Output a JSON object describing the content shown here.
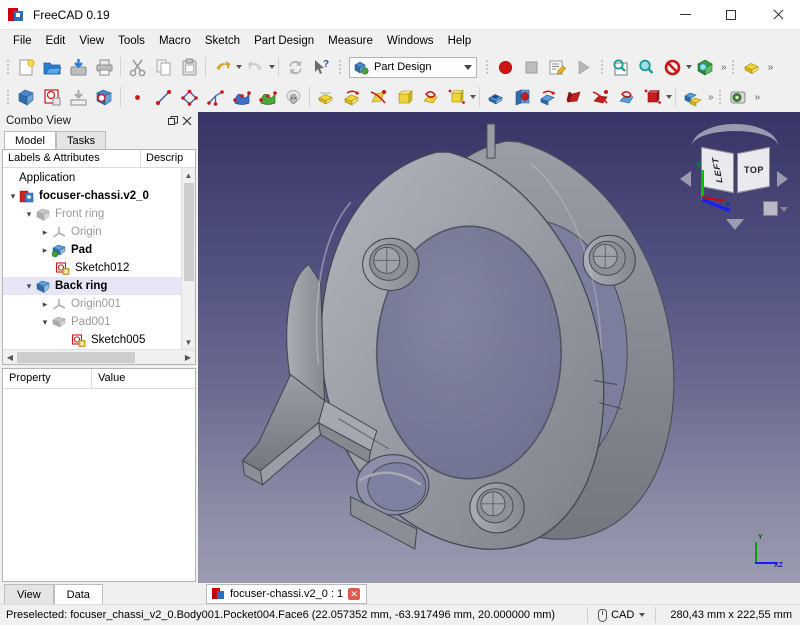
{
  "window": {
    "title": "FreeCAD 0.19",
    "app_icon": "freecad-logo-icon",
    "minimize": "minimize-icon",
    "maximize": "maximize-icon",
    "close": "close-icon"
  },
  "menubar": {
    "items": [
      {
        "label": "File"
      },
      {
        "label": "Edit"
      },
      {
        "label": "View"
      },
      {
        "label": "Tools"
      },
      {
        "label": "Macro"
      },
      {
        "label": "Sketch"
      },
      {
        "label": "Part Design"
      },
      {
        "label": "Measure"
      },
      {
        "label": "Windows"
      },
      {
        "label": "Help"
      }
    ]
  },
  "toolbar_row1": {
    "file_group": [
      {
        "name": "new-document-icon",
        "title": "New"
      },
      {
        "name": "open-document-icon",
        "title": "Open"
      },
      {
        "name": "save-document-icon",
        "title": "Save"
      },
      {
        "name": "print-document-icon",
        "title": "Print"
      }
    ],
    "edit_group": [
      {
        "name": "cut-icon",
        "title": "Cut"
      },
      {
        "name": "copy-icon",
        "title": "Copy"
      },
      {
        "name": "paste-icon",
        "title": "Paste"
      }
    ],
    "history_group": [
      {
        "name": "undo-icon",
        "title": "Undo"
      },
      {
        "name": "redo-icon",
        "title": "Redo"
      },
      {
        "name": "refresh-icon",
        "title": "Refresh"
      },
      {
        "name": "whats-this-icon",
        "title": "What's This"
      }
    ],
    "workbench": {
      "label": "Part Design",
      "icon": "part-design-workbench-icon",
      "dropdown": "chevron-down-icon"
    },
    "macro_group": [
      {
        "name": "macro-record-icon",
        "title": "Macro recording"
      },
      {
        "name": "macro-stop-icon",
        "title": "Stop macro recording"
      },
      {
        "name": "macro-edit-icon",
        "title": "Macros"
      },
      {
        "name": "macro-execute-icon",
        "title": "Execute macro"
      }
    ],
    "view_group": [
      {
        "name": "fit-all-icon",
        "title": "Fit all"
      },
      {
        "name": "zoom-icon",
        "title": "Zoom"
      },
      {
        "name": "draw-style-icon",
        "title": "Draw style"
      },
      {
        "name": "axonometric-view-icon",
        "title": "Axonometric"
      }
    ],
    "overflow": "double-chevron-icon",
    "extra_group": [
      {
        "name": "pad-yellow-icon",
        "title": "Pad"
      }
    ]
  },
  "toolbar_row2": {
    "body_group": [
      {
        "name": "create-body-icon",
        "title": "Create body"
      },
      {
        "name": "create-sketch-icon",
        "title": "Create sketch"
      },
      {
        "name": "attach-sketch-icon",
        "title": "Attach sketch"
      },
      {
        "name": "validate-sketch-icon",
        "title": "Validate sketch"
      }
    ],
    "sketcher_group": [
      {
        "name": "point-icon",
        "title": "Point"
      },
      {
        "name": "line-icon",
        "title": "Line"
      },
      {
        "name": "polyline-icon",
        "title": "Polyline"
      },
      {
        "name": "arc-icon",
        "title": "Arc"
      },
      {
        "name": "bspline-icon",
        "title": "B-spline"
      },
      {
        "name": "periodic-bspline-icon",
        "title": "Periodic B-spline"
      },
      {
        "name": "sheep-icon",
        "title": "Sketcher tool"
      }
    ],
    "additive_group": [
      {
        "name": "pad-icon",
        "title": "Pad"
      },
      {
        "name": "revolution-icon",
        "title": "Revolution"
      },
      {
        "name": "additive-loft-icon",
        "title": "Additive loft"
      },
      {
        "name": "additive-pipe-icon",
        "title": "Additive pipe"
      },
      {
        "name": "additive-helix-icon",
        "title": "Additive helix"
      },
      {
        "name": "additive-primitive-icon",
        "title": "Additive primitive"
      }
    ],
    "subtractive_group": [
      {
        "name": "pocket-icon",
        "title": "Pocket"
      },
      {
        "name": "hole-icon",
        "title": "Hole"
      },
      {
        "name": "groove-icon",
        "title": "Groove"
      },
      {
        "name": "subtractive-loft-icon",
        "title": "Subtractive loft"
      },
      {
        "name": "subtractive-pipe-icon",
        "title": "Subtractive pipe"
      },
      {
        "name": "subtractive-helix-icon",
        "title": "Subtractive helix"
      },
      {
        "name": "subtractive-primitive-icon",
        "title": "Subtractive primitive"
      }
    ],
    "boolean_group": [
      {
        "name": "boolean-operation-icon",
        "title": "Boolean operation"
      }
    ],
    "measure_group": [
      {
        "name": "measure-icon",
        "title": "Measure"
      }
    ],
    "overflow": "double-chevron-icon"
  },
  "combo_view": {
    "title": "Combo View",
    "float_button": "float-panel-icon",
    "close_button": "close-panel-icon",
    "tabs": [
      {
        "label": "Model",
        "active": true
      },
      {
        "label": "Tasks",
        "active": false
      }
    ],
    "tree_columns": [
      {
        "label": "Labels & Attributes"
      },
      {
        "label": "Descrip"
      }
    ],
    "tree": [
      {
        "label": "Application",
        "indent": 0,
        "arrow": "",
        "icon": "",
        "state": "normal"
      },
      {
        "label": "focuser-chassi.v2_0",
        "indent": 0,
        "arrow": "v",
        "icon": "document-icon",
        "state": "bold"
      },
      {
        "label": "Front ring",
        "indent": 1,
        "arrow": "v",
        "icon": "body-icon",
        "state": "dim"
      },
      {
        "label": "Origin",
        "indent": 2,
        "arrow": ">",
        "icon": "origin-icon",
        "state": "dim"
      },
      {
        "label": "Pad",
        "indent": 2,
        "arrow": ">",
        "icon": "pad-tree-icon",
        "state": "bold"
      },
      {
        "label": "Sketch012",
        "indent": 3,
        "arrow": "",
        "icon": "sketch-icon",
        "state": "normal"
      },
      {
        "label": "Back ring",
        "indent": 1,
        "arrow": "v",
        "icon": "body-blue-icon",
        "state": "bold-selected"
      },
      {
        "label": "Origin001",
        "indent": 2,
        "arrow": ">",
        "icon": "origin-icon",
        "state": "dim"
      },
      {
        "label": "Pad001",
        "indent": 2,
        "arrow": "v",
        "icon": "pad-tree-icon",
        "state": "dim"
      },
      {
        "label": "Sketch005",
        "indent": 3,
        "arrow": "",
        "icon": "sketch-icon",
        "state": "normal"
      }
    ],
    "property_columns": [
      {
        "label": "Property"
      },
      {
        "label": "Value"
      }
    ],
    "property_rows": [],
    "bottom_tabs": [
      {
        "label": "View",
        "active": false
      },
      {
        "label": "Data",
        "active": true
      }
    ]
  },
  "view3d": {
    "document_tab": {
      "label": "focuser-chassi.v2_0 : 1",
      "icon": "freecad-document-icon",
      "close": "close-tab-icon"
    },
    "nav_cube": {
      "face_left": "LEFT",
      "face_top": "TOP",
      "axis_y": "Y",
      "axis_z": "Z",
      "axis_x": "X",
      "arrow_left": "rotate-left-arrow-icon",
      "arrow_right": "rotate-right-arrow-icon",
      "arrow_down": "rotate-down-arrow-icon",
      "corner_cube": "view-cube-icon"
    },
    "origin_axis": {
      "y": "Y",
      "xz": "XZ"
    },
    "background_top": "#363566",
    "background_bottom": "#9b9cb2",
    "model_color": "#8f9299"
  },
  "statusbar": {
    "message": "Preselected: focuser_chassi_v2_0.Body001.Pocket004.Face6 (22.057352 mm, -63.917496 mm, 20.000000 mm)",
    "nav_style": "CAD",
    "nav_icon": "mouse-icon",
    "nav_dropdown": "chevron-down-icon",
    "dimensions": "280,43 mm x 222,55 mm"
  }
}
